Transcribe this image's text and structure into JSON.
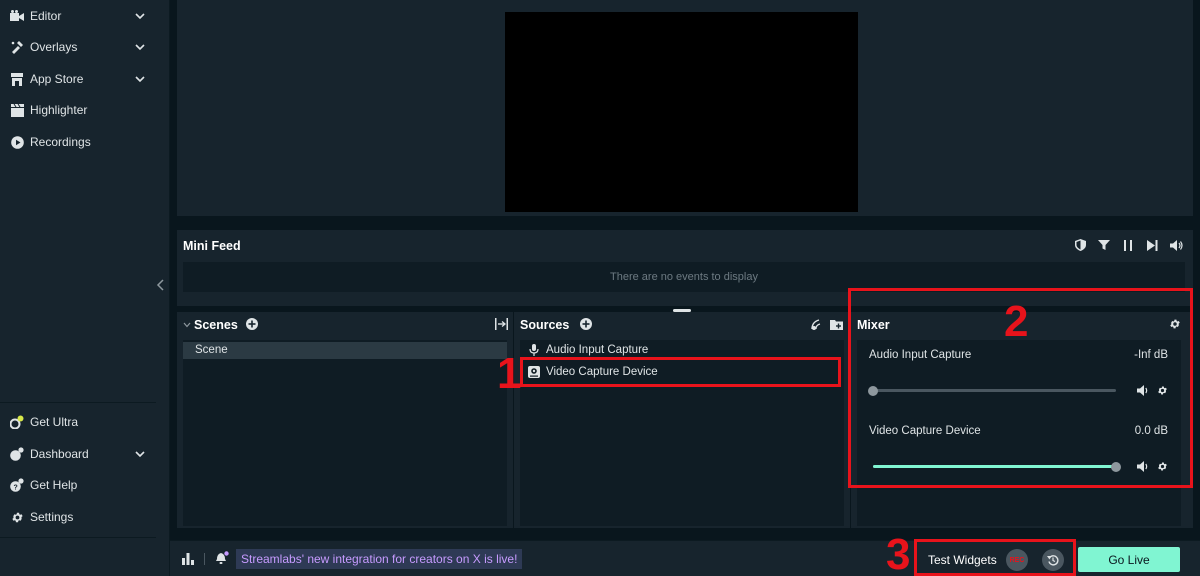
{
  "sidebar": {
    "top_items": [
      {
        "label": "Editor",
        "icon": "film-icon",
        "has_chevron": true
      },
      {
        "label": "Overlays",
        "icon": "overlays-icon",
        "has_chevron": true
      },
      {
        "label": "App Store",
        "icon": "store-icon",
        "has_chevron": true
      },
      {
        "label": "Highlighter",
        "icon": "clapper-icon",
        "has_chevron": false
      },
      {
        "label": "Recordings",
        "icon": "play-icon",
        "has_chevron": false
      }
    ],
    "bottom_items": [
      {
        "label": "Get Ultra",
        "icon": "ultra-icon",
        "has_chevron": false
      },
      {
        "label": "Dashboard",
        "icon": "dashboard-icon",
        "has_chevron": true
      },
      {
        "label": "Get Help",
        "icon": "help-icon",
        "has_chevron": false
      },
      {
        "label": "Settings",
        "icon": "gear-icon",
        "has_chevron": false
      }
    ]
  },
  "mini_feed": {
    "title": "Mini Feed",
    "empty_text": "There are no events to display"
  },
  "scenes": {
    "title": "Scenes",
    "items": [
      "Scene"
    ]
  },
  "sources": {
    "title": "Sources",
    "items": [
      {
        "label": "Audio Input Capture",
        "icon": "microphone-icon"
      },
      {
        "label": "Video Capture Device",
        "icon": "webcam-icon"
      }
    ]
  },
  "mixer": {
    "title": "Mixer",
    "channels": [
      {
        "name": "Audio Input Capture",
        "db": "-Inf dB",
        "level": 0.0
      },
      {
        "name": "Video Capture Device",
        "db": "0.0 dB",
        "level": 1.0
      }
    ]
  },
  "annotations": {
    "one": "1",
    "two": "2",
    "three": "3"
  },
  "footer": {
    "promo_text": "Streamlabs' new integration for creators on X is live!",
    "test_widgets_label": "Test Widgets",
    "rec_label": "REC",
    "go_live_label": "Go Live"
  },
  "colors": {
    "accent": "#80f5d2",
    "annotation_red": "#e8131b",
    "promo_text": "#c79bff"
  }
}
